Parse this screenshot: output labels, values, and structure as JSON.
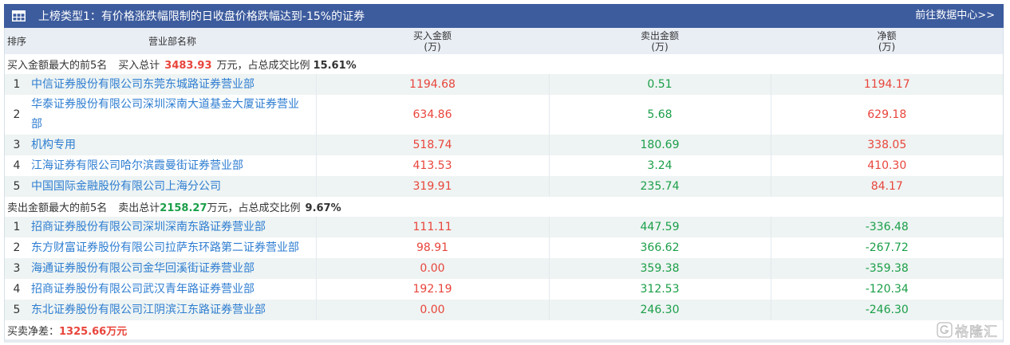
{
  "header": {
    "icon": "table-icon",
    "title": "上榜类型1：有价格涨跌幅限制的日收盘价格跌幅达到-15%的证券",
    "link": "前往数据中心>>"
  },
  "columns": {
    "rank": "排序",
    "name": "营业部名称",
    "buy": {
      "label": "买入金额",
      "unit": "(万)"
    },
    "sell": {
      "label": "卖出金额",
      "unit": "(万)"
    },
    "net": {
      "label": "净额",
      "unit": "(万)"
    }
  },
  "buy_section": {
    "label": "买入金额最大的前5名",
    "total_prefix": "买入总计",
    "total_value": "3483.93",
    "total_suffix": "万元，占总成交比例",
    "ratio": "15.61%",
    "rows": [
      {
        "rank": "1",
        "name": "中信证券股份有限公司东莞东城路证券营业部",
        "buy": "1194.68",
        "sell": "0.51",
        "net": "1194.17"
      },
      {
        "rank": "2",
        "name": "华泰证券股份有限公司深圳深南大道基金大厦证券营业部",
        "buy": "634.86",
        "sell": "5.68",
        "net": "629.18"
      },
      {
        "rank": "3",
        "name": "机构专用",
        "buy": "518.74",
        "sell": "180.69",
        "net": "338.05"
      },
      {
        "rank": "4",
        "name": "江海证券有限公司哈尔滨霞曼街证券营业部",
        "buy": "413.53",
        "sell": "3.24",
        "net": "410.30"
      },
      {
        "rank": "5",
        "name": "中国国际金融股份有限公司上海分公司",
        "buy": "319.91",
        "sell": "235.74",
        "net": "84.17"
      }
    ]
  },
  "sell_section": {
    "label": "卖出金额最大的前5名",
    "total_prefix": "卖出总计",
    "total_value": "2158.27",
    "total_suffix": "万元，占总成交比例",
    "ratio": "9.67%",
    "rows": [
      {
        "rank": "1",
        "name": "招商证券股份有限公司深圳深南东路证券营业部",
        "buy": "111.11",
        "sell": "447.59",
        "net": "-336.48"
      },
      {
        "rank": "2",
        "name": "东方财富证券股份有限公司拉萨东环路第二证券营业部",
        "buy": "98.91",
        "sell": "366.62",
        "net": "-267.72"
      },
      {
        "rank": "3",
        "name": "海通证券股份有限公司金华回溪街证券营业部",
        "buy": "0.00",
        "sell": "359.38",
        "net": "-359.38"
      },
      {
        "rank": "4",
        "name": "招商证券股份有限公司武汉青年路证券营业部",
        "buy": "192.19",
        "sell": "312.53",
        "net": "-120.34"
      },
      {
        "rank": "5",
        "name": "东北证券股份有限公司江阴滨江东路证券营业部",
        "buy": "0.00",
        "sell": "246.30",
        "net": "-246.30"
      }
    ]
  },
  "footer": {
    "label": "买卖净差：",
    "value": "1325.66万元"
  },
  "watermark": {
    "icon": "gelonghui-logo-icon",
    "text": "格隆汇"
  },
  "colors": {
    "header_bg": "#3d5c9e",
    "column_header_bg": "#e9eef5",
    "row_alt_bg": "#eef4f3",
    "up": "#e8453c",
    "down": "#1a9e48",
    "link": "#2e7dd1",
    "text": "#333333"
  }
}
